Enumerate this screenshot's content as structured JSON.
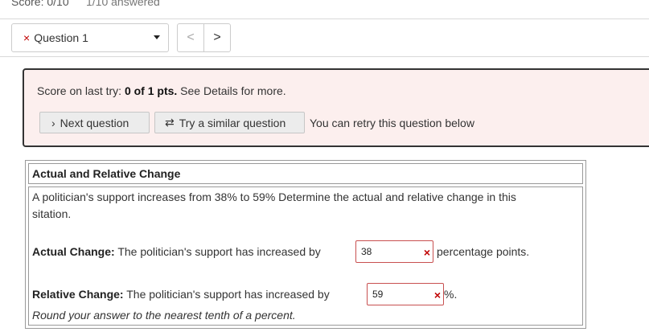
{
  "topbar": {
    "score": "Score: 0/10",
    "answered": "1/10 answered"
  },
  "question_selector": {
    "status_icon": "×",
    "label": "Question 1"
  },
  "nav": {
    "prev": "<",
    "next": ">"
  },
  "score_box": {
    "prefix": "Score on last try: ",
    "score": "0 of 1 pts.",
    "suffix": " See Details for more.",
    "next_button": "Next question",
    "next_icon": "›",
    "similar_button": "Try a similar question",
    "similar_icon": "⇄",
    "retry_text": "You can retry this question below"
  },
  "question": {
    "title": "Actual and Relative Change",
    "prompt_line1": "A politician's support increases from 38% to 59% Determine the actual and relative change in this",
    "prompt_line2": "sitation.",
    "actual_label": "Actual Change:",
    "actual_text": " The politician's support has increased by",
    "actual_value": "38",
    "actual_unit": "percentage points.",
    "relative_label": "Relative Change:",
    "relative_text": " The politician's support has increased by",
    "relative_value": "59",
    "relative_unit": "%.",
    "hint": "Round your answer to the nearest tenth of a percent.",
    "wrong_mark": "×"
  },
  "colors": {
    "error": "#c00000",
    "score_bg": "#fcefee"
  }
}
